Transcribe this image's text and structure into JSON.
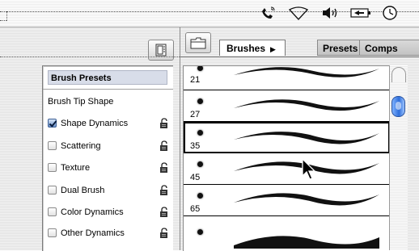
{
  "menubar": {
    "icons": [
      "phone-icon",
      "airport-icon",
      "volume-icon",
      "battery-icon",
      "clock-icon"
    ]
  },
  "left": {
    "header": "Brush Presets",
    "tip_shape": "Brush Tip Shape",
    "options": [
      {
        "label": "Shape Dynamics",
        "checked": true
      },
      {
        "label": "Scattering",
        "checked": false
      },
      {
        "label": "Texture",
        "checked": false
      },
      {
        "label": "Dual Brush",
        "checked": false
      },
      {
        "label": "Color Dynamics",
        "checked": false
      },
      {
        "label": "Other Dynamics",
        "checked": false
      }
    ]
  },
  "tabs": {
    "brushes": "Brushes",
    "presets": "Presets",
    "comps": "Comps"
  },
  "brushes": [
    {
      "size": "21",
      "selected": false
    },
    {
      "size": "27",
      "selected": false
    },
    {
      "size": "35",
      "selected": true
    },
    {
      "size": "45",
      "selected": false
    },
    {
      "size": "65",
      "selected": false
    }
  ],
  "colors": {
    "selected_border": "#000000",
    "scroll_thumb": "#2e6edb",
    "header_bg": "#d8dde9"
  }
}
